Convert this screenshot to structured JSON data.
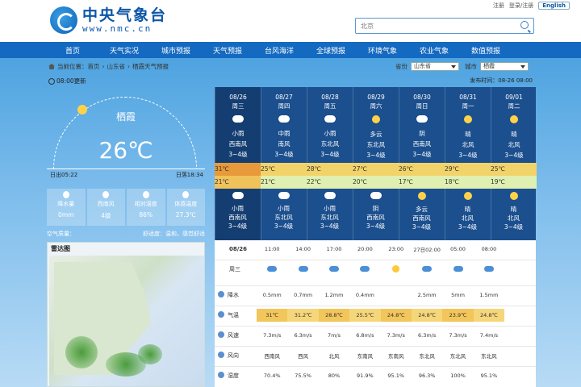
{
  "header": {
    "logo_cn": "中央气象台",
    "logo_en": "www.nmc.cn",
    "top_links": [
      "注册",
      "登录/注册"
    ],
    "lang": "English",
    "search_placeholder": "北京"
  },
  "nav": [
    "首页",
    "天气实况",
    "城市预报",
    "天气预报",
    "台风海洋",
    "全球预报",
    "环境气象",
    "农业气象",
    "数值预报"
  ],
  "breadcrumb": [
    "当前位置：首页",
    "山东省",
    "栖霞天气预报"
  ],
  "selects": {
    "province_label": "省份",
    "province": "山东省",
    "city_label": "城市",
    "city": "栖霞"
  },
  "update_text": "08:00更新",
  "publish_time": "发布时间：08-26 08:00",
  "today": {
    "city": "栖霞",
    "temp": "26℃",
    "sunrise": "日出05:22",
    "sunset": "日落18:34",
    "metrics": [
      {
        "label": "降水量",
        "value": "0mm"
      },
      {
        "label": "西南风",
        "value": "4级"
      },
      {
        "label": "相对湿度",
        "value": "86%"
      },
      {
        "label": "体感温度",
        "value": "27.3℃"
      }
    ],
    "aqi": [
      "空气质量：",
      "舒适度：温和，感觉舒适"
    ]
  },
  "forecast": [
    {
      "date": "08/26",
      "week": "周三",
      "day_w": "小雨",
      "day_wind": "西南风",
      "day_lv": "3~4级",
      "high": "31℃",
      "low": "21℃",
      "night_w": "小雨",
      "night_wind": "西南风",
      "night_lv": "3~4级",
      "icon_d": "cloud",
      "icon_n": "cloud"
    },
    {
      "date": "08/27",
      "week": "周四",
      "day_w": "中雨",
      "day_wind": "南风",
      "day_lv": "3~4级",
      "high": "25℃",
      "low": "21℃",
      "night_w": "小雨",
      "night_wind": "东北风",
      "night_lv": "3~4级",
      "icon_d": "cloud",
      "icon_n": "cloud"
    },
    {
      "date": "08/28",
      "week": "周五",
      "day_w": "小雨",
      "day_wind": "东北风",
      "day_lv": "3~4级",
      "high": "28℃",
      "low": "22℃",
      "night_w": "小雨",
      "night_wind": "东北风",
      "night_lv": "3~4级",
      "icon_d": "cloud",
      "icon_n": "cloud"
    },
    {
      "date": "08/29",
      "week": "周六",
      "day_w": "多云",
      "day_wind": "东北风",
      "day_lv": "3~4级",
      "high": "27℃",
      "low": "20℃",
      "night_w": "阴",
      "night_wind": "西南风",
      "night_lv": "3~4级",
      "icon_d": "sun",
      "icon_n": "cloud"
    },
    {
      "date": "08/30",
      "week": "周日",
      "day_w": "阴",
      "day_wind": "西南风",
      "day_lv": "3~4级",
      "high": "26℃",
      "low": "17℃",
      "night_w": "多云",
      "night_wind": "西南风",
      "night_lv": "3~4级",
      "icon_d": "cloud",
      "icon_n": "sun"
    },
    {
      "date": "08/31",
      "week": "周一",
      "day_w": "晴",
      "day_wind": "北风",
      "day_lv": "3~4级",
      "high": "29℃",
      "low": "18℃",
      "night_w": "晴",
      "night_wind": "北风",
      "night_lv": "3~4级",
      "icon_d": "sun",
      "icon_n": "sun"
    },
    {
      "date": "09/01",
      "week": "周二",
      "day_w": "晴",
      "day_wind": "北风",
      "day_lv": "3~4级",
      "high": "25℃",
      "low": "19℃",
      "night_w": "晴",
      "night_wind": "北风",
      "night_lv": "3~4级",
      "icon_d": "sun",
      "icon_n": "sun"
    }
  ],
  "hourly": {
    "date": "08/26",
    "week": "周三",
    "times": [
      "11:00",
      "14:00",
      "17:00",
      "20:00",
      "23:00",
      "27日02:00",
      "05:00",
      "08:00"
    ],
    "icons": [
      "cloud",
      "cloud",
      "cloud",
      "cloud",
      "sun",
      "cloud",
      "cloud",
      "cloud"
    ],
    "rows": [
      {
        "label": "降水",
        "values": [
          "0.5mm",
          "0.7mm",
          "1.2mm",
          "0.4mm",
          "",
          "2.5mm",
          "5mm",
          "1.5mm"
        ]
      },
      {
        "label": "气温",
        "values": [
          "31℃",
          "31.2℃",
          "28.8℃",
          "25.5℃",
          "24.8℃",
          "24.8℃",
          "23.9℃",
          "24.8℃"
        ]
      },
      {
        "label": "风速",
        "values": [
          "7.3m/s",
          "6.3m/s",
          "7m/s",
          "6.8m/s",
          "7.3m/s",
          "6.3m/s",
          "7.3m/s",
          "7.4m/s"
        ]
      },
      {
        "label": "风向",
        "values": [
          "西南风",
          "西风",
          "北风",
          "东南风",
          "东南风",
          "东北风",
          "东北风",
          "东北风"
        ]
      },
      {
        "label": "湿度",
        "values": [
          "70.4%",
          "75.5%",
          "80%",
          "91.9%",
          "95.1%",
          "96.3%",
          "100%",
          "95.1%"
        ]
      }
    ]
  },
  "radar": {
    "title": "雷达图"
  }
}
